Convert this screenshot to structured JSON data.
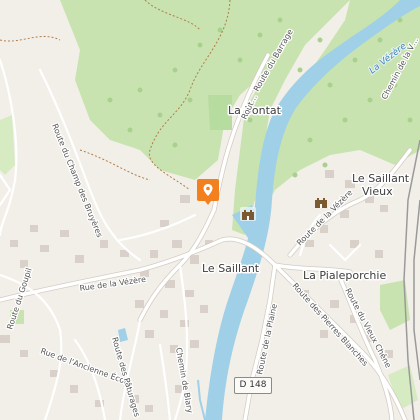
{
  "map": {
    "places": {
      "la_bontat": "La Bontat",
      "le_saillant": "Le Saillant",
      "le_saillant_vieux_1": "Le Saillant",
      "le_saillant_vieux_2": "Vieux",
      "la_pialeporchie": "La Pialeporchie"
    },
    "roads": {
      "route_du_barrage": "Route du Barrage",
      "route_du_champ_des_bruyeres": "Route du Champ des Bruyères",
      "rue_de_la_vezere": "Rue de la Vézère",
      "route_du_goupil": "Route du Goupil",
      "rue_de_lancienne_ecole": "Rue de l'Ancienne École",
      "route_des_paturages": "Route des Pâturages",
      "route_de_la_plaine": "Route de la Plaine",
      "chemin_de_blary": "Chemin de Blary",
      "route_de_la_vezere": "Route de la Vézère",
      "route_du_vieux_chene": "Route du Vieux Chêne",
      "route_des_pierres_blanches": "Route des Pierres Blanches",
      "chemin_de_la_v": "Chemin de la V…",
      "route_du_barrage_partial": "Rout…"
    },
    "river": "La Vézère",
    "road_shield": "D 148",
    "colors": {
      "background": "#f2efe9",
      "forest": "#c8e3b0",
      "water": "#9fd0e8",
      "marker": "#f2801f",
      "river_label": "#3f86b5"
    },
    "icons": [
      "location-pin-icon",
      "castle-icon",
      "castle-icon"
    ]
  }
}
